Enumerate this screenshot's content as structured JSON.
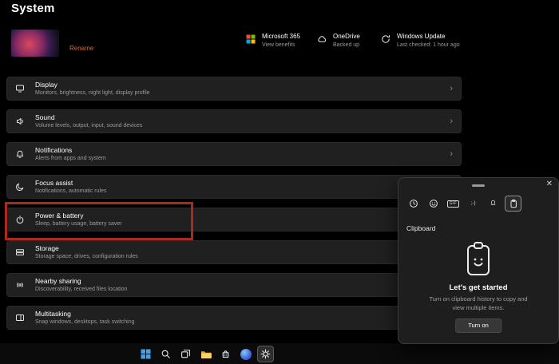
{
  "header": {
    "title": "System"
  },
  "profile": {
    "rename": "Rename"
  },
  "glyphs": {
    "chevron": "›",
    "close": "✕"
  },
  "status": {
    "items": [
      {
        "title": "Microsoft 365",
        "subtitle": "View benefits",
        "icon": "microsoft-logo-icon"
      },
      {
        "title": "OneDrive",
        "subtitle": "Backed up",
        "icon": "onedrive-cloud-icon"
      },
      {
        "title": "Windows Update",
        "subtitle": "Last checked: 1 hour ago",
        "icon": "windows-update-icon"
      }
    ]
  },
  "settings": {
    "rows": [
      {
        "title": "Display",
        "subtitle": "Monitors, brightness, night light, display profile",
        "icon": "display-icon"
      },
      {
        "title": "Sound",
        "subtitle": "Volume levels, output, input, sound devices",
        "icon": "sound-icon"
      },
      {
        "title": "Notifications",
        "subtitle": "Alerts from apps and system",
        "icon": "notifications-bell-icon"
      },
      {
        "title": "Focus assist",
        "subtitle": "Notifications, automatic rules",
        "icon": "focus-assist-moon-icon"
      },
      {
        "title": "Power & battery",
        "subtitle": "Sleep, battery usage, battery saver",
        "icon": "power-icon",
        "highlighted": true
      },
      {
        "title": "Storage",
        "subtitle": "Storage space, drives, configuration rules",
        "icon": "storage-icon"
      },
      {
        "title": "Nearby sharing",
        "subtitle": "Discoverability, received files location",
        "icon": "nearby-sharing-icon"
      },
      {
        "title": "Multitasking",
        "subtitle": "Snap windows, desktops, task switching",
        "icon": "multitasking-icon"
      }
    ]
  },
  "annotation": {
    "color": "#ad291f",
    "target": "Power & battery"
  },
  "clipboard_panel": {
    "label": "Clipboard",
    "heading": "Let's get started",
    "description": "Turn on clipboard history to copy and view multiple items.",
    "button": "Turn on",
    "tabs": [
      {
        "name": "recent-clock-icon"
      },
      {
        "name": "emoji-icon"
      },
      {
        "name": "gif-icon",
        "glyph": "GIF"
      },
      {
        "name": "kaomoji-icon",
        "glyph": ";-)"
      },
      {
        "name": "symbols-icon",
        "glyph": "Ω"
      },
      {
        "name": "clipboard-icon",
        "selected": true
      }
    ]
  },
  "taskbar": {
    "icons": [
      "start",
      "search",
      "task-view",
      "file-explorer",
      "store",
      "edge",
      "settings"
    ],
    "active": "settings"
  }
}
